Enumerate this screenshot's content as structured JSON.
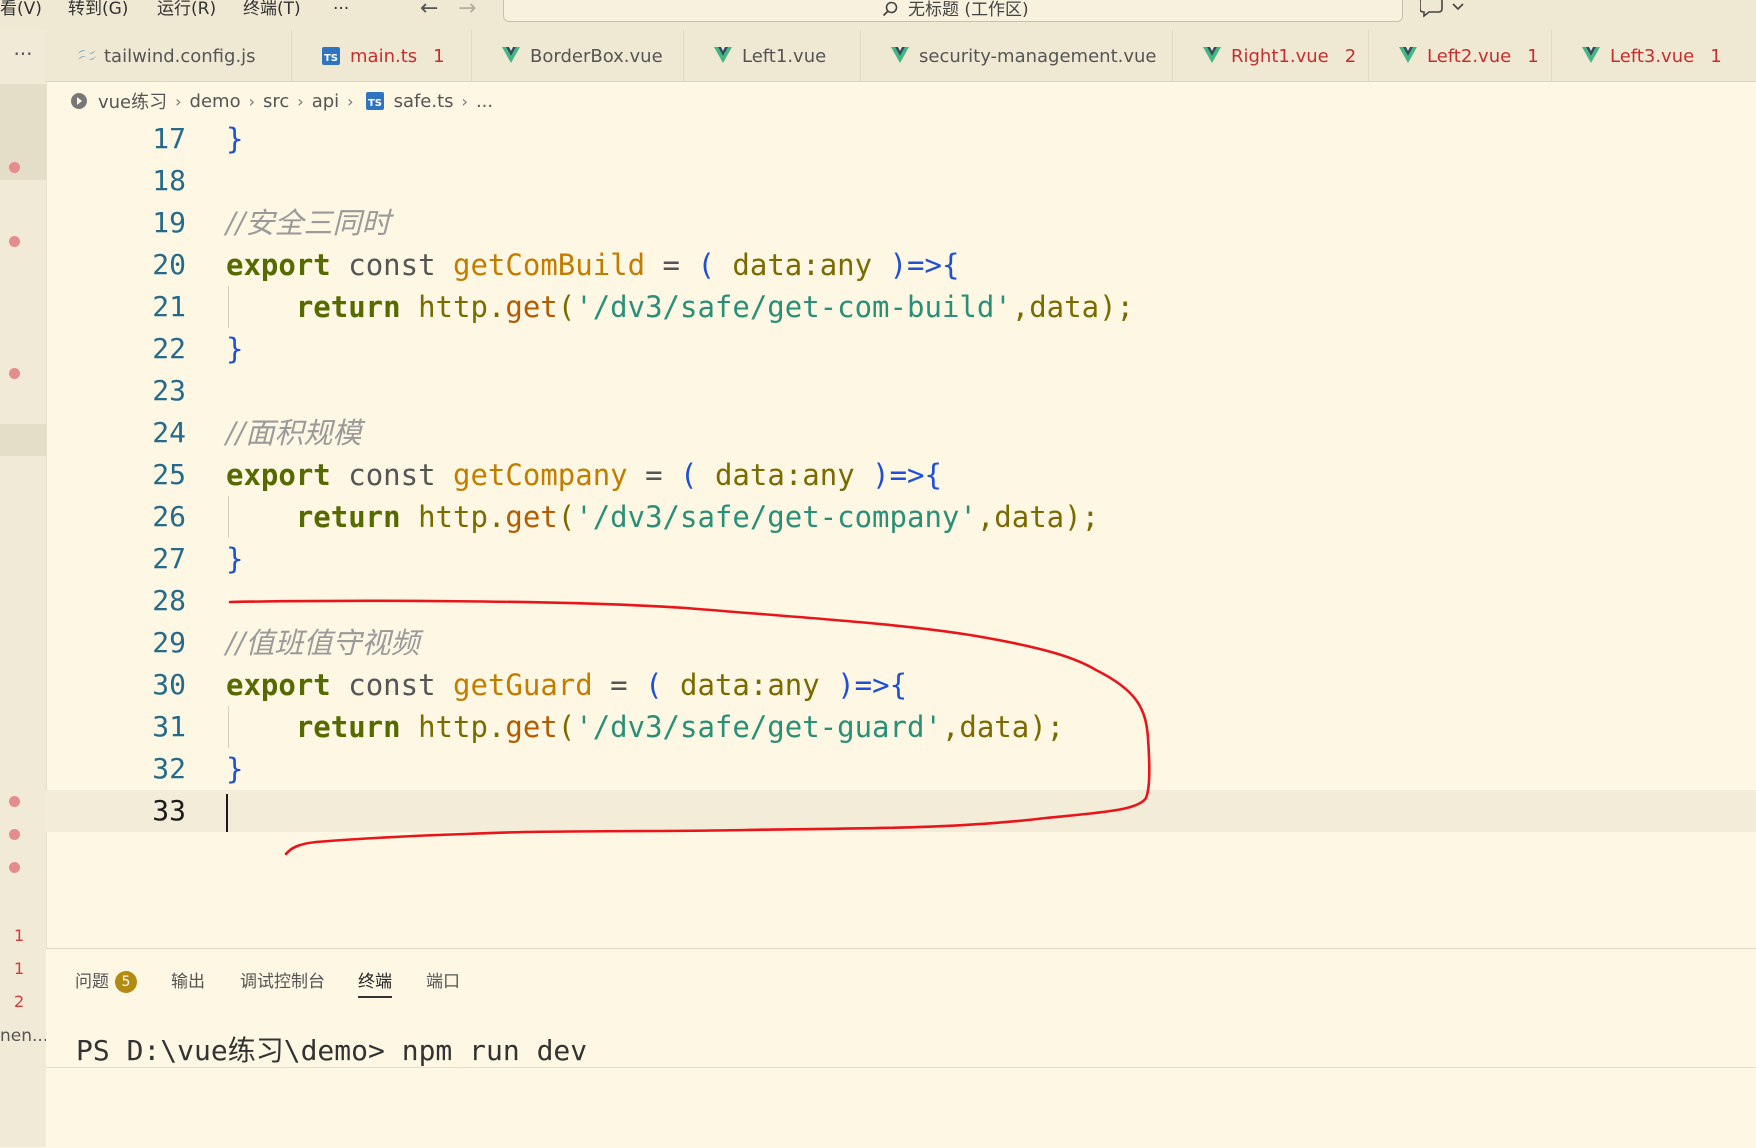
{
  "menu": {
    "view": "看(V)",
    "goto": "转到(G)",
    "run": "运行(R)",
    "terminal": "终端(T)",
    "more": "···"
  },
  "command_center": {
    "label": "无标题 (工作区)"
  },
  "tabs_overflow": "···",
  "tabs": [
    {
      "label": "tailwind.config.js",
      "icon": "tailwind-icon",
      "count": "",
      "error": false
    },
    {
      "label": "main.ts",
      "icon": "typescript-icon",
      "count": "1",
      "error": true
    },
    {
      "label": "BorderBox.vue",
      "icon": "vue-icon",
      "count": "",
      "error": false
    },
    {
      "label": "Left1.vue",
      "icon": "vue-icon",
      "count": "",
      "error": false
    },
    {
      "label": "security-management.vue",
      "icon": "vue-icon",
      "count": "",
      "error": false
    },
    {
      "label": "Right1.vue",
      "icon": "vue-icon",
      "count": "2",
      "error": true
    },
    {
      "label": "Left2.vue",
      "icon": "vue-icon",
      "count": "1",
      "error": true
    },
    {
      "label": "Left3.vue",
      "icon": "vue-icon",
      "count": "1",
      "error": true
    }
  ],
  "breadcrumb": {
    "items": [
      "vue练习",
      "demo",
      "src",
      "api",
      "safe.ts",
      "..."
    ]
  },
  "activity": {
    "counts": [
      "1",
      "1",
      "2"
    ],
    "label": "nen..."
  },
  "editor": {
    "lines": [
      {
        "n": "17"
      },
      {
        "n": "18"
      },
      {
        "n": "19"
      },
      {
        "n": "20"
      },
      {
        "n": "21"
      },
      {
        "n": "22"
      },
      {
        "n": "23"
      },
      {
        "n": "24"
      },
      {
        "n": "25"
      },
      {
        "n": "26"
      },
      {
        "n": "27"
      },
      {
        "n": "28"
      },
      {
        "n": "29"
      },
      {
        "n": "30"
      },
      {
        "n": "31"
      },
      {
        "n": "32"
      },
      {
        "n": "33"
      }
    ],
    "tokens": {
      "brace_close": "}",
      "comment_1": "//安全三同时",
      "comment_2": "//面积规模",
      "comment_3": "//值班值守视频",
      "export": "export",
      "const": "const",
      "fn_1": "getComBuild",
      "fn_2": "getCompany",
      "fn_3": "getGuard",
      "eq": "=",
      "open_paren": "(",
      "data": "data",
      "colon_any": ":any",
      "arrow": ")=>",
      "brace_open": "{",
      "return": "return",
      "http": "http.",
      "get": "get",
      "call_open": "(",
      "url_1": "'/dv3/safe/get-com-build'",
      "url_2": "'/dv3/safe/get-company'",
      "url_3": "'/dv3/safe/get-guard'",
      "comma": ",",
      "call_close": ");"
    }
  },
  "panel": {
    "tabs": [
      "问题",
      "输出",
      "调试控制台",
      "终端",
      "端口"
    ],
    "problems_badge": "5",
    "active_tab": "终端",
    "terminal_prompt": "PS D:\\vue练习\\demo> npm run dev"
  }
}
